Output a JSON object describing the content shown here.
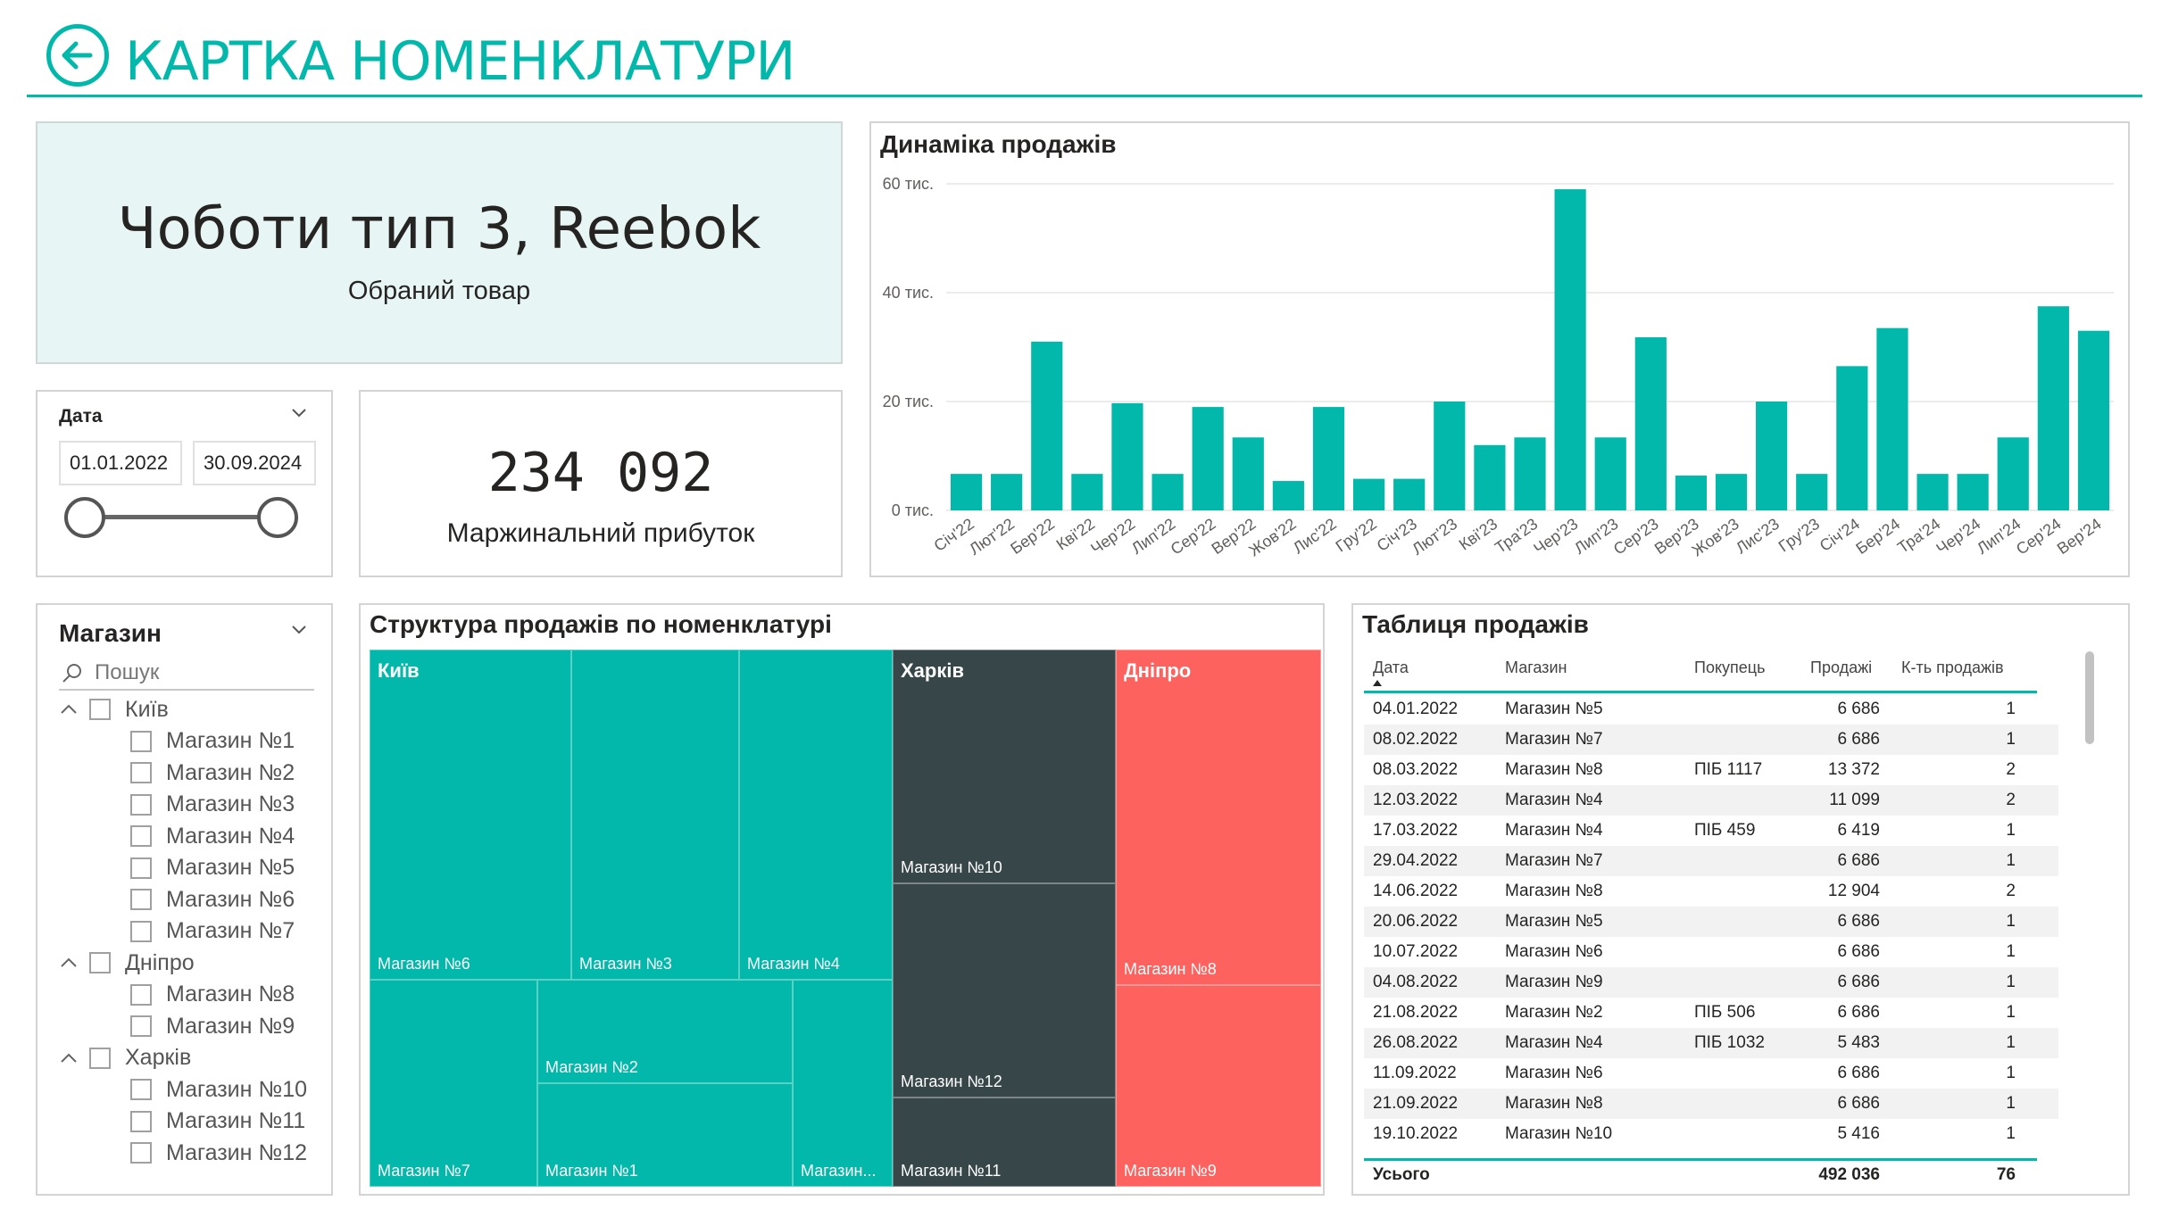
{
  "header": {
    "title": "КАРТКА НОМЕНКЛАТУРИ"
  },
  "product": {
    "name": "Чоботи тип 3, Reebok",
    "caption": "Обраний товар"
  },
  "date_slicer": {
    "label": "Дата",
    "start": "01.01.2022",
    "end": "30.09.2024"
  },
  "kpi": {
    "value": "234 092",
    "label": "Маржинальний прибуток"
  },
  "chart_data": {
    "type": "bar",
    "title": "Динаміка продажів",
    "xlabel": "",
    "ylabel": "",
    "ylim": [
      0,
      60
    ],
    "y_ticks": [
      "0 тис.",
      "20 тис.",
      "40 тис.",
      "60 тис."
    ],
    "y_tick_values": [
      0,
      20,
      40,
      60
    ],
    "categories": [
      "Січ'22",
      "Лют'22",
      "Бер'22",
      "Кві'22",
      "Чер'22",
      "Лип'22",
      "Сер'22",
      "Вер'22",
      "Жов'22",
      "Лис'22",
      "Гру'22",
      "Січ'23",
      "Лют'23",
      "Кві'23",
      "Тра'23",
      "Чер'23",
      "Лип'23",
      "Сер'23",
      "Вер'23",
      "Жов'23",
      "Лис'23",
      "Гру'23",
      "Січ'24",
      "Бер'24",
      "Тра'24",
      "Чер'24",
      "Лип'24",
      "Сер'24",
      "Вер'24"
    ],
    "values": [
      6.7,
      6.7,
      31.0,
      6.7,
      19.7,
      6.7,
      19.0,
      13.4,
      5.4,
      19.0,
      5.8,
      5.8,
      20.0,
      12.0,
      13.4,
      59.0,
      13.4,
      31.8,
      6.4,
      6.7,
      20.0,
      6.7,
      26.5,
      33.5,
      6.7,
      6.7,
      13.4,
      37.5,
      33.0
    ],
    "color": "#01B8AA"
  },
  "store_slicer": {
    "label": "Магазин",
    "search_placeholder": "Пошук",
    "groups": [
      {
        "name": "Київ",
        "items": [
          "Магазин №1",
          "Магазин №2",
          "Магазин №3",
          "Магазин №4",
          "Магазин №5",
          "Магазин №6",
          "Магазин №7"
        ]
      },
      {
        "name": "Дніпро",
        "items": [
          "Магазин №8",
          "Магазин №9"
        ]
      },
      {
        "name": "Харків",
        "items": [
          "Магазин №10",
          "Магазин №11",
          "Магазин №12"
        ]
      }
    ]
  },
  "treemap": {
    "title": "Структура продажів по номенклатурі",
    "colors": {
      "kyiv": "#01B8AA",
      "kharkiv": "#374649",
      "dnipro": "#FD625E"
    },
    "groups": {
      "kyiv": "Київ",
      "kharkiv": "Харків",
      "dnipro": "Дніпро"
    },
    "labels": {
      "s6": "Магазин №6",
      "s3": "Магазин №3",
      "s4": "Магазин №4",
      "s2": "Магазин №2",
      "s7": "Магазин №7",
      "s1": "Магазин №1",
      "s5": "Магазин...",
      "s10": "Магазин №10",
      "s12": "Магазин №12",
      "s11": "Магазин №11",
      "s8": "Магазин №8",
      "s9": "Магазин №9"
    }
  },
  "table": {
    "title": "Таблиця продажів",
    "columns": [
      "Дата",
      "Магазин",
      "Покупець",
      "Продажі",
      "К-ть продажів"
    ],
    "rows": [
      [
        "04.01.2022",
        "Магазин №5",
        "",
        "6 686",
        "1"
      ],
      [
        "08.02.2022",
        "Магазин №7",
        "",
        "6 686",
        "1"
      ],
      [
        "08.03.2022",
        "Магазин №8",
        "ПІБ 1117",
        "13 372",
        "2"
      ],
      [
        "12.03.2022",
        "Магазин №4",
        "",
        "11 099",
        "2"
      ],
      [
        "17.03.2022",
        "Магазин №4",
        "ПІБ 459",
        "6 419",
        "1"
      ],
      [
        "29.04.2022",
        "Магазин №7",
        "",
        "6 686",
        "1"
      ],
      [
        "14.06.2022",
        "Магазин №8",
        "",
        "12 904",
        "2"
      ],
      [
        "20.06.2022",
        "Магазин №5",
        "",
        "6 686",
        "1"
      ],
      [
        "10.07.2022",
        "Магазин №6",
        "",
        "6 686",
        "1"
      ],
      [
        "04.08.2022",
        "Магазин №9",
        "",
        "6 686",
        "1"
      ],
      [
        "21.08.2022",
        "Магазин №2",
        "ПІБ 506",
        "6 686",
        "1"
      ],
      [
        "26.08.2022",
        "Магазин №4",
        "ПІБ 1032",
        "5 483",
        "1"
      ],
      [
        "11.09.2022",
        "Магазин №6",
        "",
        "6 686",
        "1"
      ],
      [
        "21.09.2022",
        "Магазин №8",
        "",
        "6 686",
        "1"
      ],
      [
        "19.10.2022",
        "Магазин №10",
        "",
        "5 416",
        "1"
      ]
    ],
    "total": {
      "label": "Усього",
      "sales": "492 036",
      "count": "76"
    }
  }
}
